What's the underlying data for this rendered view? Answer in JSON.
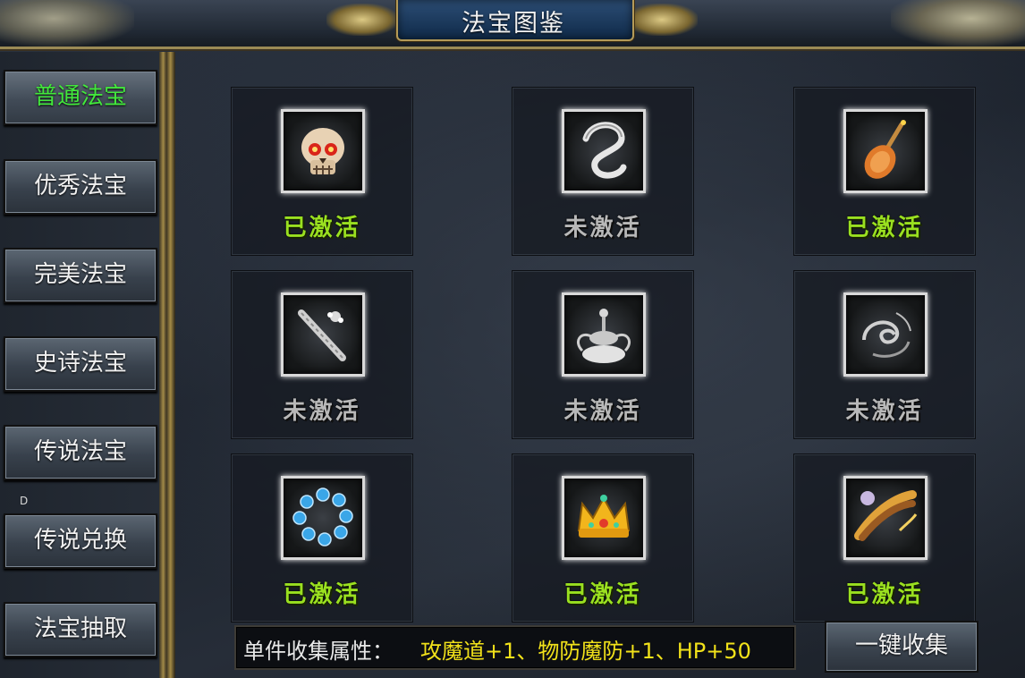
{
  "window": {
    "title": "法宝图鉴"
  },
  "sidebar": {
    "items": [
      {
        "label": "普通法宝",
        "active": true
      },
      {
        "label": "优秀法宝",
        "active": false
      },
      {
        "label": "完美法宝",
        "active": false
      },
      {
        "label": "史诗法宝",
        "active": false
      },
      {
        "label": "传说法宝",
        "active": false
      },
      {
        "label": "传说兑换",
        "active": false
      },
      {
        "label": "法宝抽取",
        "active": false
      }
    ],
    "marker": "D"
  },
  "grid": {
    "items": [
      {
        "icon": "skull-icon",
        "status": "已激活",
        "activated": true
      },
      {
        "icon": "silver-ribbon-icon",
        "status": "未激活",
        "activated": false
      },
      {
        "icon": "pipa-lute-icon",
        "status": "已激活",
        "activated": true
      },
      {
        "icon": "flower-staff-icon",
        "status": "未激活",
        "activated": false
      },
      {
        "icon": "incense-burner-icon",
        "status": "未激活",
        "activated": false
      },
      {
        "icon": "swirl-cloud-icon",
        "status": "未激活",
        "activated": false
      },
      {
        "icon": "blue-bead-bracelet-icon",
        "status": "已激活",
        "activated": true
      },
      {
        "icon": "golden-crown-icon",
        "status": "已激活",
        "activated": true
      },
      {
        "icon": "guqin-zither-icon",
        "status": "已激活",
        "activated": true
      }
    ]
  },
  "attributes": {
    "label": "单件收集属性：",
    "value": "攻魔道+1、物防魔防+1、HP+50"
  },
  "actions": {
    "collect_all": "一键收集"
  },
  "colors": {
    "activated": "#9ae020",
    "inactive": "#b8b8b8",
    "active_tab": "#42e83c",
    "attribute_value": "#f2e21a"
  }
}
